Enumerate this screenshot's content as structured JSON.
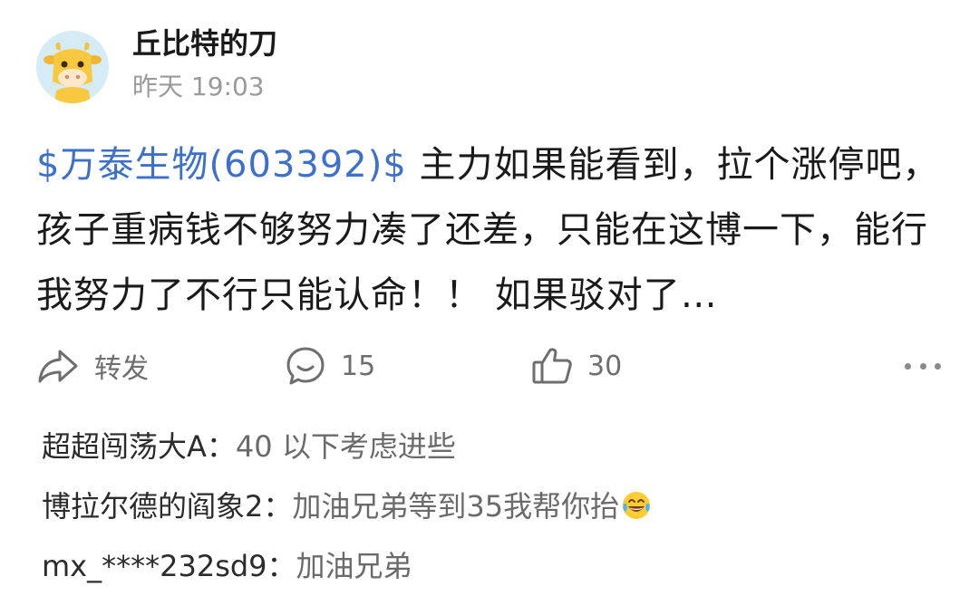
{
  "post": {
    "author": "丘比特的刀",
    "time": "昨天 19:03",
    "avatar_icon": "cow-avatar-icon",
    "stock_link": "$万泰生物(603392)$",
    "text": " 主力如果能看到，拉个涨停吧，孩子重病钱不够努力凑了还差，只能在这博一下，能行我努力了不行只能认命！！ 如果驳对了…"
  },
  "actions": {
    "forward_icon": "share-arrow-icon",
    "forward_label": "转发",
    "comment_icon": "comment-bubble-icon",
    "comment_count": "15",
    "like_icon": "thumbs-up-icon",
    "like_count": "30",
    "more_icon": "more-dots-icon"
  },
  "comments": [
    {
      "user": "超超闯荡大A",
      "sep": "：",
      "text": "40 以下考虑进些"
    },
    {
      "user": "博拉尔德的阎象2",
      "sep": "：",
      "text": "加油兄弟等到35我帮你抬",
      "emoji": "tears-of-joy-emoji"
    },
    {
      "user": "mx_****232sd9",
      "sep": "：",
      "text": "加油兄弟"
    }
  ],
  "colors": {
    "link": "#3c70c9",
    "text": "#1a1a1a",
    "muted": "#9a9a9a",
    "icon": "#6e6e6e"
  }
}
